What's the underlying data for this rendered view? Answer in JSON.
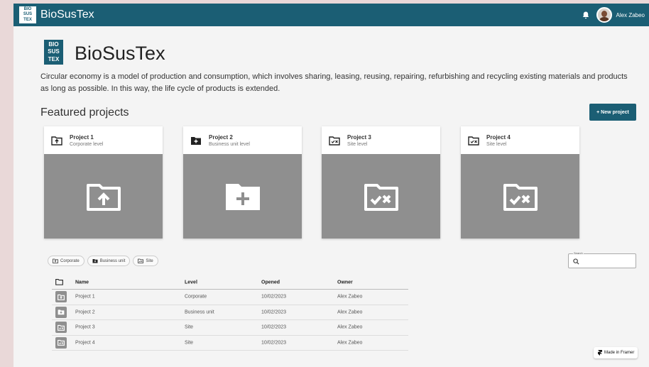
{
  "app": {
    "logo_lines": [
      "BIO",
      "SUS",
      "TEX"
    ],
    "title": "BioSusTex",
    "user_name": "Alex Zabeo"
  },
  "hero": {
    "title": "BioSusTex",
    "intro": "Circular economy is a model of production and consumption, which involves sharing, leasing, reusing, repairing, refurbishing and recycling existing materials and products as long as possible. In this way, the life cycle of products is extended."
  },
  "featured": {
    "title": "Featured projects",
    "new_button": "+ New project",
    "cards": [
      {
        "name": "Project 1",
        "level": "Corporate level",
        "icon": "folder-upload-icon"
      },
      {
        "name": "Project 2",
        "level": "Business unit level",
        "icon": "folder-add-icon"
      },
      {
        "name": "Project 3",
        "level": "Site level",
        "icon": "folder-check-cross-icon"
      },
      {
        "name": "Project 4",
        "level": "Site level",
        "icon": "folder-check-cross-icon"
      }
    ]
  },
  "filters": {
    "chips": [
      "Corporate",
      "Business unit",
      "Site"
    ],
    "search_label": "Search"
  },
  "table": {
    "headers": {
      "name": "Name",
      "level": "Level",
      "opened": "Opened",
      "owner": "Owner"
    },
    "rows": [
      {
        "name": "Project 1",
        "level": "Corporate",
        "opened": "10/02/2023",
        "owner": "Alex Zabeo"
      },
      {
        "name": "Project 2",
        "level": "Business unit",
        "opened": "10/02/2023",
        "owner": "Alex Zabeo"
      },
      {
        "name": "Project 3",
        "level": "Site",
        "opened": "10/02/2023",
        "owner": "Alex Zabeo"
      },
      {
        "name": "Project 4",
        "level": "Site",
        "opened": "10/02/2023",
        "owner": "Alex Zabeo"
      }
    ]
  },
  "badge": {
    "label": "Made in Framer"
  },
  "colors": {
    "brand": "#1b5e74",
    "media_gray": "#8f8f8f"
  }
}
